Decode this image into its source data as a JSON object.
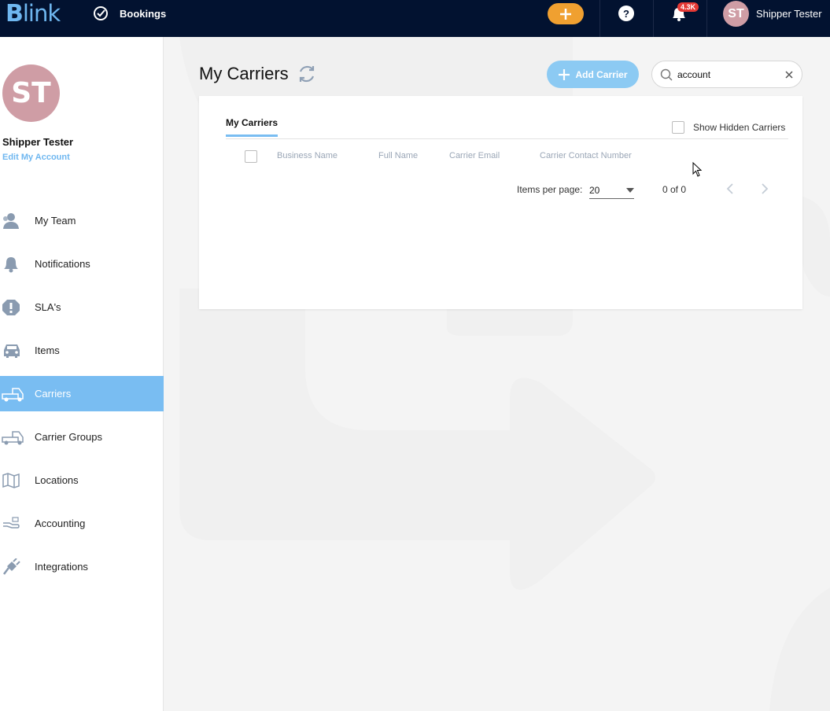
{
  "topbar": {
    "logo_b": "B",
    "logo_rest": "link",
    "nav_bookings": "Bookings",
    "notification_badge": "4.3K",
    "help_label": "?",
    "user_initials": "ST",
    "user_name": "Shipper Tester"
  },
  "sidebar": {
    "initials": "ST",
    "name": "Shipper Tester",
    "edit_link": "Edit My Account",
    "items": [
      {
        "label": "My Team",
        "icon": "team-icon"
      },
      {
        "label": "Notifications",
        "icon": "bell-icon"
      },
      {
        "label": "SLA's",
        "icon": "alert-icon"
      },
      {
        "label": "Items",
        "icon": "car-icon"
      },
      {
        "label": "Carriers",
        "icon": "truck-icon",
        "active": true
      },
      {
        "label": "Carrier Groups",
        "icon": "truck-icon"
      },
      {
        "label": "Locations",
        "icon": "map-icon"
      },
      {
        "label": "Accounting",
        "icon": "hand-icon"
      },
      {
        "label": "Integrations",
        "icon": "plug-icon"
      }
    ]
  },
  "main": {
    "title": "My Carriers",
    "add_button": "Add Carrier",
    "search_value": "account",
    "tab": "My Carriers",
    "show_hidden": "Show Hidden Carriers",
    "columns": [
      "Business Name",
      "Full Name",
      "Carrier Email",
      "Carrier Contact Number"
    ],
    "items_per_page_label": "Items per page:",
    "items_per_page": "20",
    "range": "0 of 0"
  },
  "colors": {
    "topbar": "#021230",
    "accent": "#79bdf2",
    "plus_button": "#f0a030",
    "avatar": "#cf9da5",
    "badge": "#e53935"
  }
}
